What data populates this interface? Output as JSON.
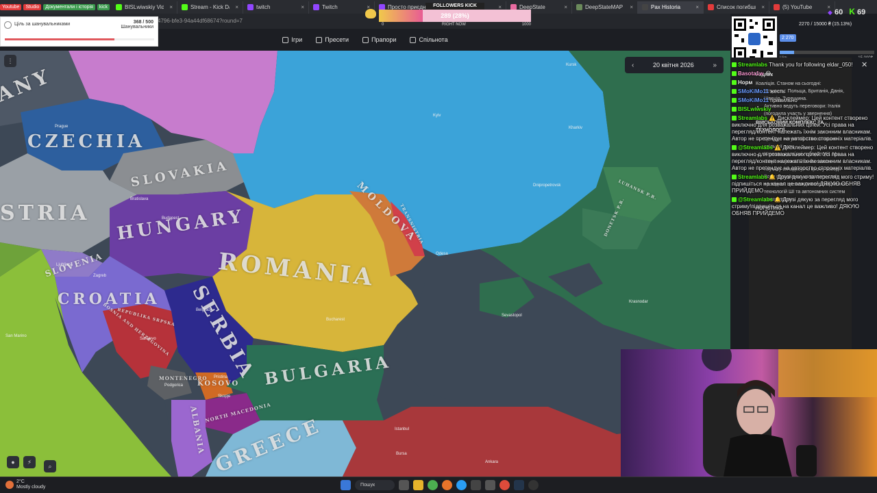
{
  "bookmarks": [
    {
      "label": "Youtube",
      "color": "#e23b3b"
    },
    {
      "label": "Studio",
      "color": "#e23b3b"
    },
    {
      "label": "Документали і історія",
      "color": "#3a9a4d"
    },
    {
      "label": "kick",
      "color": "#3a9a4d"
    }
  ],
  "tabs": [
    {
      "label": "BISLwiwskiy Videos - Wat",
      "color": "#53fc18"
    },
    {
      "label": "Stream - Kick Dashboard",
      "color": "#53fc18"
    },
    {
      "label": "twitch",
      "color": "#9146ff"
    },
    {
      "label": "Twitch",
      "color": "#9146ff"
    },
    {
      "label": "Просто приєднуйся в чат",
      "color": "#9146ff"
    },
    {
      "label": "Poll",
      "color": "#e96aa0"
    },
    {
      "label": "DeepState",
      "color": "#e96aa0"
    },
    {
      "label": "DeepStateMAP | День 14",
      "color": "#6b8a5b"
    },
    {
      "label": "Pax Historia",
      "color": "#444",
      "active": true
    },
    {
      "label": "Список погибших на вой",
      "color": "#e23b3b"
    },
    {
      "label": "(5) YouTube",
      "color": "#e23b3b"
    }
  ],
  "address": {
    "url_fragment": "4796-bfe3-94a44df68674?round=7"
  },
  "nav": [
    {
      "label": "Ігри",
      "icon": "gamepad-icon"
    },
    {
      "label": "Пресети",
      "icon": "preset-icon"
    },
    {
      "label": "Прапори",
      "icon": "flag-icon"
    },
    {
      "label": "Спільнота",
      "icon": "people-icon"
    }
  ],
  "date_widget": {
    "prev": "‹",
    "date": "20 квітня 2026",
    "next": "»"
  },
  "sub_goal": {
    "title": "Ціль за шанувальниками",
    "count": "368 / 500",
    "sub": "Шанувальники",
    "progress": 0.736
  },
  "followers": {
    "label": "FOLLOWERS KICK",
    "value": "289 (28%)",
    "min": "0",
    "mid": "RIGHT NOW",
    "max": "1000",
    "progress": 0.289
  },
  "goal2": {
    "title": "2270 / 15000 ₴ (15.13%)",
    "pill": "2 270",
    "min": "Ціль",
    "max": "15 000₴",
    "progress": 0.1513
  },
  "viewers": {
    "a": "60",
    "b": "69"
  },
  "countries": [
    {
      "name": "CZECHIA"
    },
    {
      "name": "SLOVAKIA"
    },
    {
      "name": "HUNGARY"
    },
    {
      "name": "ROMANIA"
    },
    {
      "name": "MOLDOVA"
    },
    {
      "name": "SERBIA"
    },
    {
      "name": "CROATIA"
    },
    {
      "name": "BULGARIA"
    },
    {
      "name": "GREECE"
    },
    {
      "name": "KOSOVO"
    },
    {
      "name": "MONTENEGRO"
    },
    {
      "name": "ALBANIA"
    },
    {
      "name": "NORTH MACEDONIA"
    },
    {
      "name": "SLOVENIA"
    },
    {
      "name": "TRANSNISTRIA"
    },
    {
      "name": "LUHANSK P.R."
    },
    {
      "name": "DONETSK P.R."
    },
    {
      "name": "STRIA"
    },
    {
      "name": "ANY"
    },
    {
      "name": "BOSNIA AND HERZEGOVINA"
    },
    {
      "name": "REPUBLIKA SRPSKA"
    }
  ],
  "cities": [
    "Kyiv",
    "Prague",
    "Bratislava",
    "Budapest",
    "Ljubljana",
    "Zagreb",
    "Belgrade",
    "Sarajevo",
    "Podgorica",
    "Pristina",
    "Skopje",
    "Bucharest",
    "Odesa",
    "Dnipropetrovsk",
    "Kharkiv",
    "Kursk",
    "Sevastopol",
    "Krasnodar",
    "Istanbul",
    "Ankara",
    "Bursa",
    "San Marino"
  ],
  "doc": {
    "lines": [
      {
        "type": "h",
        "text": "Радник"
      },
      {
        "type": "p",
        "text": "Коаліція. Станом на сьогодні:"
      },
      {
        "type": "li",
        "text": "Вступили: Польща, Британія, Данія, Швеція, Туреччина."
      },
      {
        "type": "li",
        "text": "Активно ведуть переговори: Італія (погодила участь у звернення)"
      },
      {
        "type": "h",
        "text": "ВІЙСЬКОВИЙ КОМПЛЕКС ТА ТЕХНОЛОГІЇ"
      },
      {
        "type": "li",
        "text": "Це буде потужний символ нашої спільної сили."
      },
      {
        "type": "li",
        "text": "Науково-дослідні лабораторії. Ми запропонували Японії очолити наукову складову на цьому заводі. Вони погодилися направити своїх провідних вчених для впровадження технологій ШІ та автономних систем у нашi дрони."
      },
      {
        "type": "h",
        "text": "ЛОГІСТИКА"
      }
    ]
  },
  "chat": [
    {
      "user": "Streamlabs",
      "text": "Thank you for following eldar_050!",
      "color": "#53fc18"
    },
    {
      "user": "Basota1w",
      "text": "😂",
      "color": "#ff9bd6"
    },
    {
      "user": "Норм",
      "text": "",
      "color": "#eee"
    },
    {
      "user": "SMoKiMo11",
      "text": "жесть",
      "color": "#6b9bff"
    },
    {
      "user": "SMoKiMo11",
      "text": "правильно",
      "color": "#6b9bff"
    },
    {
      "user": "BISLwiwskiy",
      "text": "",
      "color": "#53fc18"
    },
    {
      "user": "Streamlabs",
      "text": "⚠️ Дисклеймер: Цей контент створено виключно для розважальних цілей. Усі права на перегляд/контент належать їхнім законним власникам. Автор не претендує на авторство сторонніх матеріалів.",
      "color": "#53fc18"
    },
    {
      "user": "@Streamlabs",
      "text": "⚠️ Дисклеймер: Цей контент створено виключно для розважальних цілей. Усі права на перегляд/контент належать їхнім законним власникам. Автор не претендує на авторство сторонніх матеріалів.",
      "color": "#53fc18"
    },
    {
      "user": "Streamlabs",
      "text": "🔔 Друзі дякую за перегляд мого стриму!підпишіться на канал це важливо! ДЯКУЮ ОБНЯВ ПРИЙДЕМО",
      "color": "#53fc18"
    },
    {
      "user": "@Streamlabs",
      "text": "🔔 Друзі дякую за перегляд мого стриму!підпишіться на канал це важливо! ДЯКУЮ ОБНЯВ ПРИЙДЕМО",
      "color": "#53fc18"
    }
  ],
  "weather": {
    "temp": "2°C",
    "desc": "Mostly cloudy"
  },
  "taskbar": {
    "search": "Пошук"
  }
}
